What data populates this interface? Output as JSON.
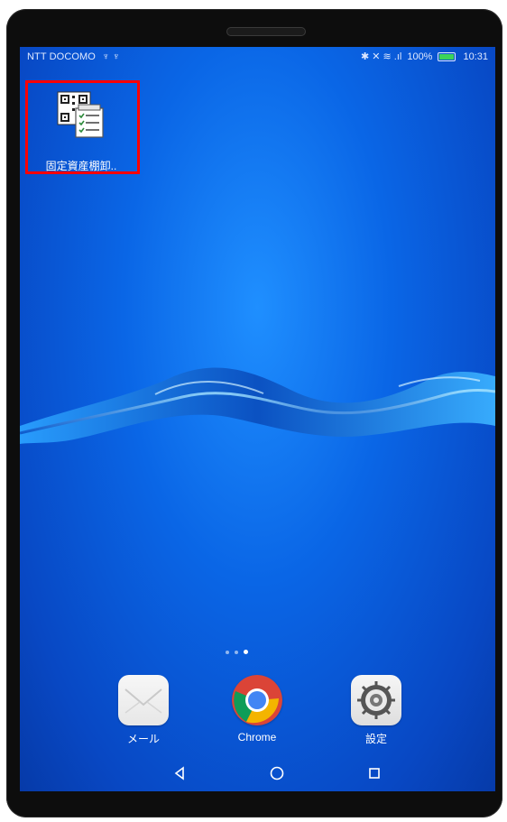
{
  "status_bar": {
    "carrier": "NTT DOCOMO",
    "usb_icons": "♆ ♆",
    "icons_right": "✱ ✕ ≋ .ıl",
    "battery_percent": "100%",
    "time": "10:31"
  },
  "home": {
    "highlighted_app": {
      "label": "固定資産棚卸..",
      "icon": "qr-checklist-icon"
    },
    "page_indicator": {
      "pages": 3,
      "active_index": 2
    }
  },
  "dock": [
    {
      "label": "メール",
      "icon": "mail-icon"
    },
    {
      "label": "Chrome",
      "icon": "chrome-icon"
    },
    {
      "label": "設定",
      "icon": "settings-icon"
    }
  ],
  "nav": {
    "back": "back-icon",
    "home": "home-icon",
    "recents": "recents-icon"
  },
  "colors": {
    "highlight": "#ff0000",
    "wallpaper": "#0a66e6",
    "battery_fill": "#3cd35a"
  }
}
